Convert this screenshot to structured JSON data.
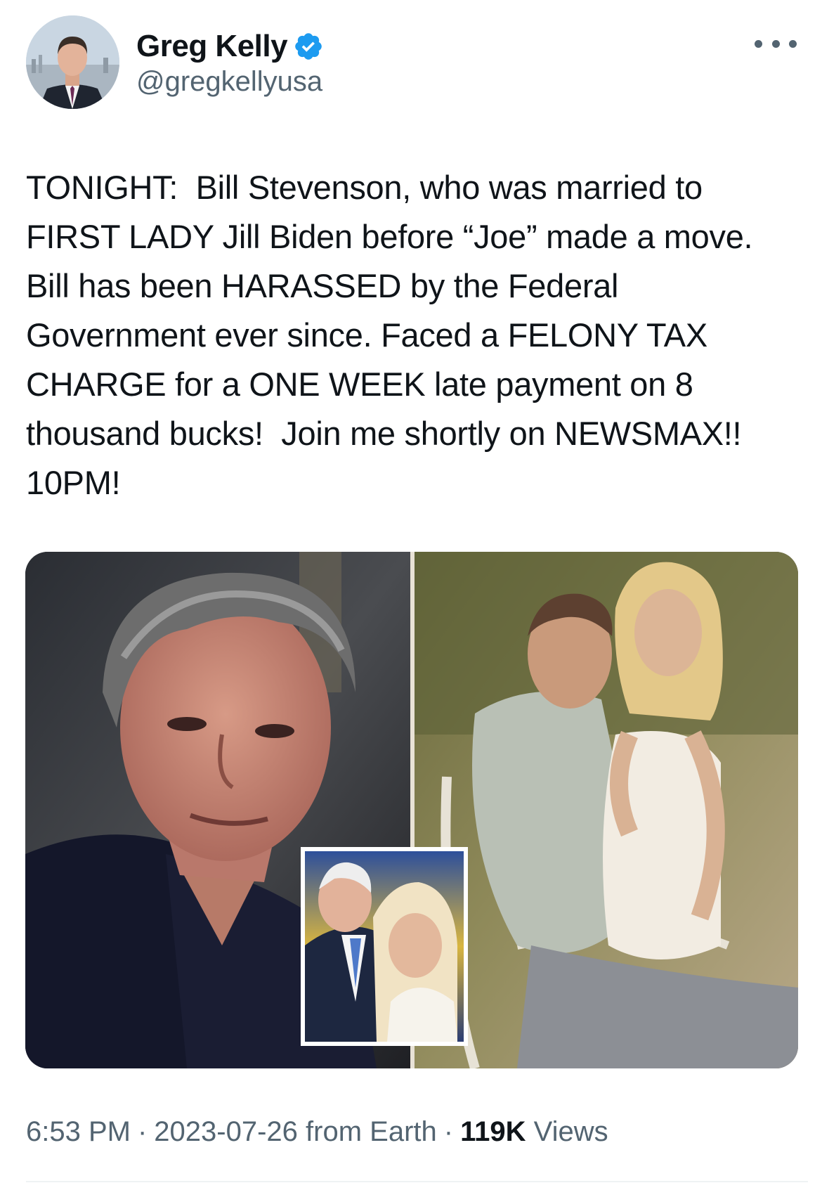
{
  "author": {
    "display_name": "Greg Kelly",
    "handle": "@gregkellyusa",
    "verified": true,
    "verified_color": "#1d9bf0"
  },
  "tweet": {
    "text": "TONIGHT:  Bill Stevenson, who was married to FIRST LADY Jill Biden before “Joe” made a move. Bill has been HARASSED by the Federal Government ever since. Faced a FELONY TAX CHARGE for a ONE WEEK late payment on 8 thousand bucks!  Join me shortly on NEWSMAX!! 10PM!"
  },
  "meta": {
    "time": "6:53 PM",
    "date": "2023-07-26",
    "source": "from Earth",
    "views_count": "119K",
    "views_label": "Views",
    "separator": "·"
  },
  "icons": {
    "verified": "verified-badge-icon",
    "more": "more-options-icon"
  }
}
